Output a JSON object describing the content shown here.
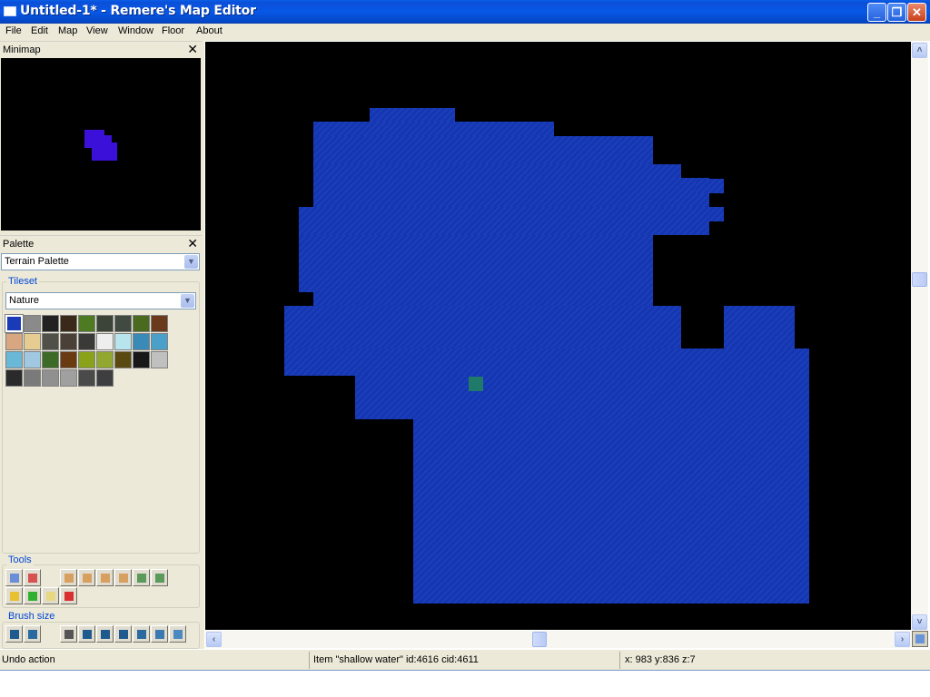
{
  "window": {
    "title": "Untitled-1* - Remere's Map Editor",
    "controls": [
      "minimize",
      "restore",
      "close"
    ]
  },
  "menu": [
    "File",
    "Edit",
    "Map",
    "View",
    "Window",
    "Floor",
    "About"
  ],
  "minimap": {
    "title": "Minimap",
    "close_glyph": "✕"
  },
  "palette": {
    "title": "Palette",
    "close_glyph": "✕",
    "palette_type": "Terrain Palette",
    "tileset_label": "Tileset",
    "tileset": "Nature",
    "brushes": [
      {
        "name": "water",
        "color": "#1a3bb8"
      },
      {
        "name": "gray-stone",
        "color": "#8a8a8a"
      },
      {
        "name": "stairs-dark",
        "color": "#222222"
      },
      {
        "name": "stairs-brown",
        "color": "#3a2818"
      },
      {
        "name": "grass",
        "color": "#4e7a22"
      },
      {
        "name": "rock-dark",
        "color": "#3c4438"
      },
      {
        "name": "rock-moss",
        "color": "#404a40"
      },
      {
        "name": "grass-dark",
        "color": "#4a6a20"
      },
      {
        "name": "mud",
        "color": "#6a3a1c"
      },
      {
        "name": "sand-cracked",
        "color": "#d8a680"
      },
      {
        "name": "sand",
        "color": "#e6cc90"
      },
      {
        "name": "rock-sand",
        "color": "#505048"
      },
      {
        "name": "rock-brown",
        "color": "#4a4038"
      },
      {
        "name": "rock-gray",
        "color": "#3a3a38"
      },
      {
        "name": "snow",
        "color": "#eeeeee"
      },
      {
        "name": "ice",
        "color": "#b8e4ee"
      },
      {
        "name": "ice-rock",
        "color": "#3a8ab8"
      },
      {
        "name": "ice-rock-2",
        "color": "#4aa0c8"
      },
      {
        "name": "ice-rock-3",
        "color": "#6ab8d8"
      },
      {
        "name": "ice-crystal",
        "color": "#a0c8e0"
      },
      {
        "name": "jungle-grass",
        "color": "#3e6a28"
      },
      {
        "name": "dirt",
        "color": "#6a3a10"
      },
      {
        "name": "yellow-grass",
        "color": "#8aa21a"
      },
      {
        "name": "lime-grass",
        "color": "#90a830"
      },
      {
        "name": "brown-earth",
        "color": "#5a4a10"
      },
      {
        "name": "black-soil",
        "color": "#181818"
      },
      {
        "name": "light-gravel",
        "color": "#c0c0c0"
      },
      {
        "name": "dark-gravel",
        "color": "#2a2a2a"
      },
      {
        "name": "cobble",
        "color": "#7a7a7a"
      },
      {
        "name": "stone-floor",
        "color": "#909090"
      },
      {
        "name": "gravel",
        "color": "#a0a0a0"
      },
      {
        "name": "dark-stone",
        "color": "#4a4a4a"
      },
      {
        "name": "darker-stone",
        "color": "#3e3e40"
      }
    ]
  },
  "tools": {
    "label": "Tools",
    "row1": [
      {
        "name": "select-tool",
        "color": "#6a8ed8"
      },
      {
        "name": "eraser-tool",
        "color": "#d85050"
      },
      {
        "name": "door-normal",
        "color": "#d8a060"
      },
      {
        "name": "door-locked",
        "color": "#d8a060"
      },
      {
        "name": "door-magic",
        "color": "#d8a060"
      },
      {
        "name": "door-quest",
        "color": "#d8a060"
      },
      {
        "name": "window-normal",
        "color": "#5a9a5a"
      },
      {
        "name": "window-hatch",
        "color": "#5a9a5a"
      }
    ],
    "row2": [
      {
        "name": "pz-tool",
        "color": "#e8c030"
      },
      {
        "name": "nopvp-tool",
        "color": "#30b030"
      },
      {
        "name": "nologout-tool",
        "color": "#e8d880"
      },
      {
        "name": "pvpzone-tool",
        "color": "#d83030"
      }
    ]
  },
  "brush_size": {
    "label": "Brush size",
    "shapes": [
      "square",
      "circle"
    ],
    "sizes": [
      "1",
      "2",
      "3",
      "4",
      "5",
      "6",
      "7"
    ]
  },
  "map": {
    "tile_type": "shallow water",
    "water_color": "#1538b8",
    "selected_tile_color": "#1f7a6a"
  },
  "status": {
    "left": "Undo action",
    "middle": "Item \"shallow water\" id:4616 cid:4611",
    "right": "x: 983 y:836 z:7"
  }
}
